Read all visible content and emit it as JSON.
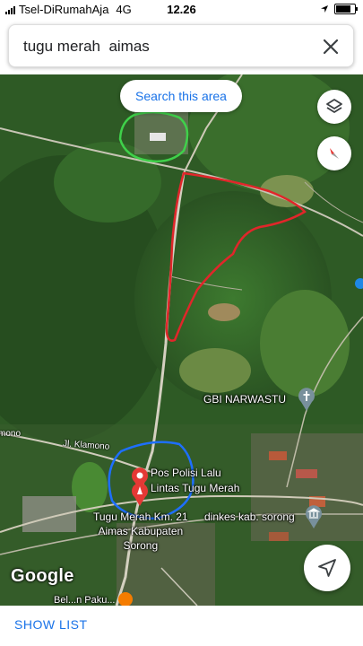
{
  "status_bar": {
    "carrier": "Tsel-DiRumahAja",
    "network": "4G",
    "time": "12.26",
    "icons": [
      "signal-icon",
      "location-arrow-icon",
      "battery-icon"
    ],
    "battery_level": 0.9
  },
  "search": {
    "query": "tugu merah  aimas",
    "clear_icon": "close-icon"
  },
  "map": {
    "search_area_label": "Search this area",
    "layers_icon": "layers-icon",
    "compass_icon": "compass-icon",
    "my_location_icon": "navigation-arrow-icon",
    "places": [
      {
        "label": "GBI NARWASTU",
        "icon": "church-icon"
      },
      {
        "label": "Pos Polisi Lalu\nLintas Tugu Merah",
        "icon": "map-pin-icon"
      },
      {
        "label": "Tugu Merah Km. 21\nAimas Kabupaten\nSorong",
        "icon": "map-pin-icon"
      },
      {
        "label": "dinkes kab. sorong",
        "icon": "government-building-icon"
      }
    ],
    "roads": [
      "Jl. Klamono",
      "mono"
    ],
    "partial_label": "Bel...n Paku...",
    "attribution": "Google",
    "annotation_colors": {
      "green": "#3fd14a",
      "red": "#e0262a",
      "blue": "#1e6fff"
    }
  },
  "bottom": {
    "show_list_label": "SHOW LIST"
  }
}
